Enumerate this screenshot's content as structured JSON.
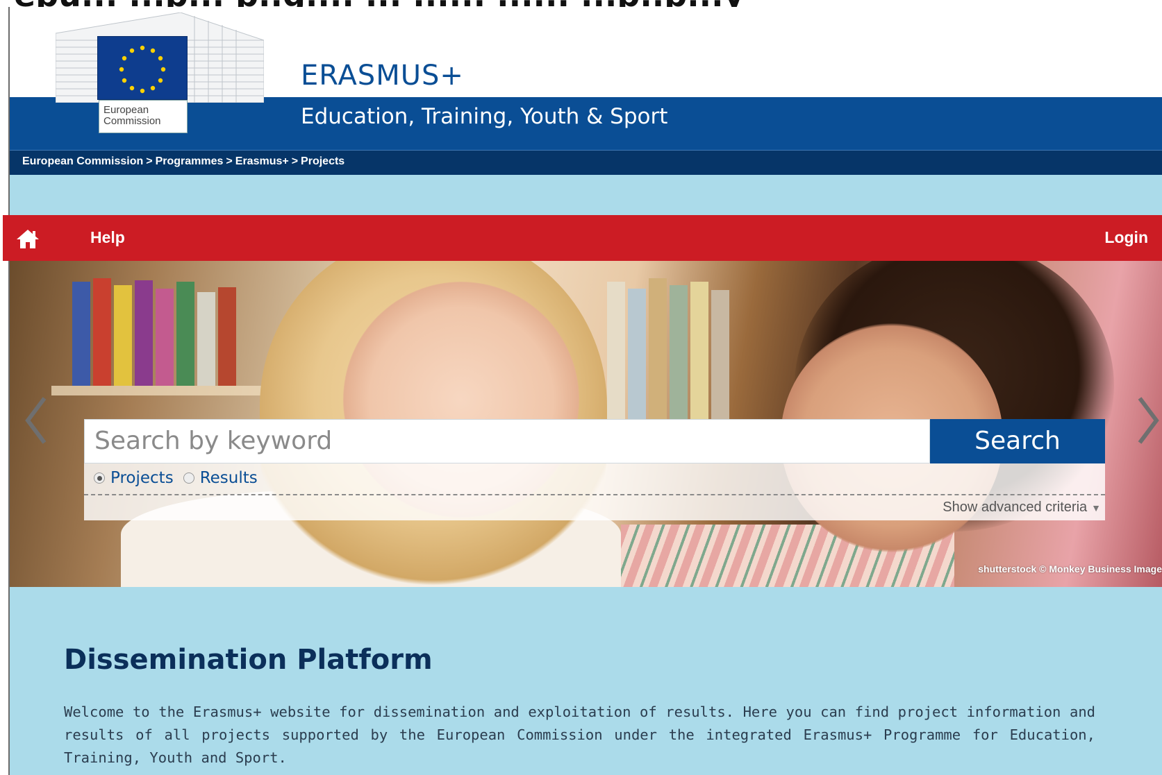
{
  "top_clip_text": "epu... ...p... p..g.... ... ...... ...... ...p..p...y",
  "header": {
    "logo_line1": "European",
    "logo_line2": "Commission",
    "title": "ERASMUS+",
    "subtitle": "Education, Training, Youth & Sport"
  },
  "breadcrumb": [
    "European Commission",
    "Programmes",
    "Erasmus+",
    "Projects"
  ],
  "breadcrumb_separator": ">",
  "nav": {
    "home_icon": "home-icon",
    "help": "Help",
    "login": "Login"
  },
  "hero": {
    "credit": "shutterstock © Monkey Business Image"
  },
  "search": {
    "placeholder": "Search by keyword",
    "button": "Search",
    "options": [
      {
        "label": "Projects",
        "checked": true
      },
      {
        "label": "Results",
        "checked": false
      }
    ],
    "advanced": "Show advanced criteria"
  },
  "content": {
    "title": "Dissemination Platform",
    "text": "Welcome to the Erasmus+ website for dissemination and exploitation of results. Here you can find project information and results of all projects supported by the European Commission under the integrated Erasmus+ Programme for Education, Training, Youth and Sport."
  },
  "colors": {
    "header_blue": "#0a4e95",
    "breadcrumb_bar": "#063568",
    "nav_red": "#cc1c24",
    "content_bg": "#abdbea",
    "title_text": "#0b2f5a"
  }
}
